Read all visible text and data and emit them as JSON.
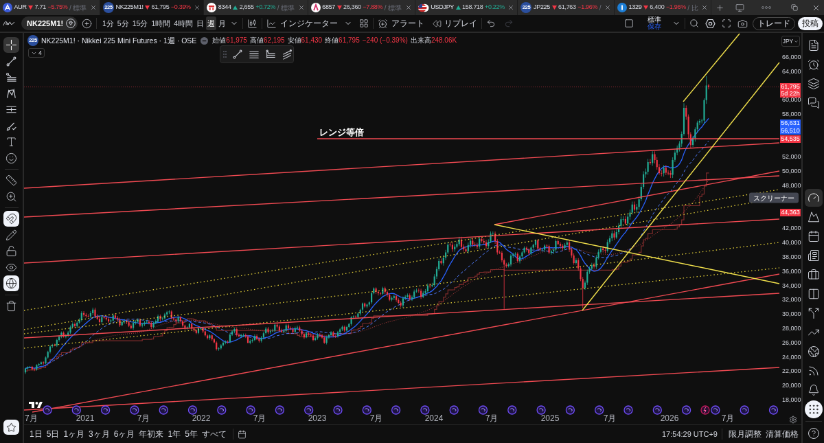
{
  "tabs": [
    {
      "symbol": "AUR",
      "down": true,
      "price": "7.71",
      "change": "−5.75%",
      "suffix": "/ 標準",
      "selected": false
    },
    {
      "symbol": "NK225M1!",
      "icon_text": "225",
      "down": true,
      "price": "61,795",
      "change": "−0.39%",
      "selected": true
    },
    {
      "symbol": "8344",
      "down": false,
      "price": "2,655",
      "change": "+0.72%",
      "suffix": "/ 標準",
      "selected": false
    },
    {
      "symbol": "6857",
      "down": true,
      "price": "26,360",
      "change": "−7.88%",
      "suffix": "/ 標準",
      "selected": false
    },
    {
      "symbol": "USDJPY",
      "down": false,
      "price": "158.718",
      "change": "+0.22%",
      "selected": false
    },
    {
      "symbol": "JP225",
      "icon_text": "225",
      "down": true,
      "price": "61,763",
      "change": "−1.96%",
      "suffix": "/",
      "selected": false
    },
    {
      "symbol": "1329",
      "down": true,
      "price": "6,400",
      "change": "−1.96%",
      "suffix": "/ 比",
      "selected": false
    }
  ],
  "toolbar": {
    "symbol": "NK225M1!",
    "intervals": [
      {
        "label": "1分",
        "selected": false
      },
      {
        "label": "5分",
        "selected": false
      },
      {
        "label": "15分",
        "selected": false
      },
      {
        "label": "1時間",
        "selected": false
      },
      {
        "label": "4時間",
        "selected": false
      },
      {
        "label": "日",
        "selected": false
      },
      {
        "label": "週",
        "selected": true
      },
      {
        "label": "月",
        "selected": false
      }
    ],
    "indicators": "インジケーター",
    "alert": "アラート",
    "replay": "リプレイ",
    "redo": {
      "disabled": true
    },
    "layout": {
      "name": "標準",
      "status": "保存"
    },
    "trade_button": "トレード",
    "publish_button": "投稿"
  },
  "left_toolbar": {
    "tools": [
      {
        "selected": true
      },
      {
        "selected": false
      },
      {
        "selected": false
      },
      {
        "selected": false
      },
      {
        "selected": false
      },
      {
        "selected": false
      },
      {
        "selected": false
      },
      {
        "selected": false
      },
      {
        "selected": false
      },
      {
        "selected": false
      }
    ],
    "toggles": [
      {
        "on": true
      },
      {
        "on": false
      },
      {
        "on": false
      },
      {
        "on": false
      },
      {
        "on": true
      }
    ],
    "favorites": {
      "on": true
    }
  },
  "legend": {
    "icon_text": "225",
    "title": "NK225M1! · Nikkei 225 Mini Futures · 1週 · OSE",
    "down": true,
    "values": [
      {
        "label": "始値",
        "value": "61,975"
      },
      {
        "label": "高値",
        "value": "62,195"
      },
      {
        "label": "安値",
        "value": "61,430"
      },
      {
        "label": "終値",
        "value": "61,795"
      }
    ],
    "change": "−240 (−0.39%)",
    "volume_label": "出来高",
    "volume": "248.06K",
    "indicator_count": "4"
  },
  "chart": {
    "annotation": "レンジ等倍",
    "currency": "JPY",
    "price_labels": [
      "66,000",
      "64,000",
      "60,000",
      "58,000",
      "52,000",
      "50,000",
      "48,000",
      "42,000",
      "40,000",
      "38,000",
      "36,000",
      "34,000",
      "32,000",
      "30,000",
      "28,000",
      "26,000",
      "24,000",
      "22,000",
      "20,000",
      "18,000"
    ],
    "badges": [
      {
        "text": "61,795",
        "color": "#f23645"
      },
      {
        "text": "5d 22h",
        "color": "#f23645"
      },
      {
        "text": "56,631",
        "color": "#2962ff"
      },
      {
        "text": "56,510",
        "color": "#2962ff"
      },
      {
        "text": "54,535",
        "color": "#f23645"
      },
      {
        "text": "44,363",
        "color": "#f23645"
      }
    ],
    "time_labels": [
      "7月",
      "2021",
      "7月",
      "2022",
      "7月",
      "2023",
      "7月",
      "2024",
      "7月",
      "2025",
      "7月",
      "2026",
      "7月"
    ]
  },
  "right_sidebar": {
    "items": [
      {
        "selected": false
      },
      {
        "selected": false
      },
      {
        "selected": false
      },
      {
        "selected": false
      },
      {
        "selected": true
      },
      {
        "selected": false
      },
      {
        "selected": false
      },
      {
        "selected": false
      },
      {
        "selected": false
      },
      {
        "selected": false
      },
      {
        "selected": false
      },
      {
        "selected": false
      },
      {
        "selected": false
      },
      {
        "selected": false
      },
      {
        "selected": false
      },
      {
        "selected": false
      },
      {
        "selected": false
      }
    ],
    "tooltip": "スクリーナー"
  },
  "bottom_bar": {
    "ranges": [
      "1日",
      "5日",
      "1ヶ月",
      "3ヶ月",
      "6ヶ月",
      "年初来",
      "1年",
      "5年",
      "すべて"
    ],
    "clock": "17:54:29 UTC+9",
    "options": [
      "限月調整",
      "清算価格"
    ]
  }
}
